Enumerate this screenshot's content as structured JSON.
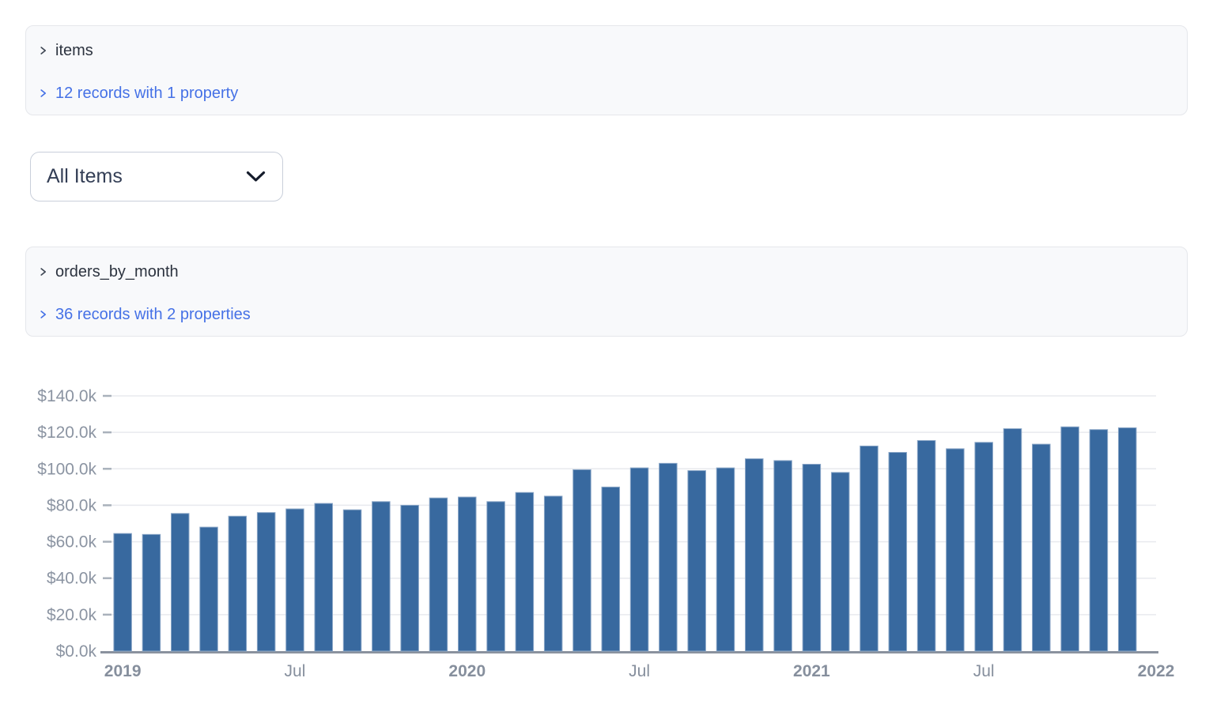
{
  "tables": [
    {
      "name": "items",
      "records_summary": "12 records with 1 property"
    },
    {
      "name": "orders_by_month",
      "records_summary": "36 records with 2 properties"
    }
  ],
  "filter": {
    "selected": "All Items",
    "icon": "chevron-down-icon"
  },
  "icons": {
    "panel_row": "chevron-right-icon",
    "dropdown": "chevron-down-icon"
  },
  "colors": {
    "link_accent": "#4571e6",
    "bar_fill": "#38699f",
    "bar_stroke": "#8aa6c7",
    "panel_bg": "#f8f9fb",
    "panel_border": "#e5e7eb",
    "gridline": "#e8eaee",
    "axis_line": "#8a929e",
    "axis_text": "#8b94a2",
    "x_axis_text": "#868f9d"
  },
  "chart_data": {
    "type": "bar",
    "title": "",
    "xlabel": "",
    "ylabel": "",
    "categories": [
      "Jan 2019",
      "Feb 2019",
      "Mar 2019",
      "Apr 2019",
      "May 2019",
      "Jun 2019",
      "Jul 2019",
      "Aug 2019",
      "Sep 2019",
      "Oct 2019",
      "Nov 2019",
      "Dec 2019",
      "Jan 2020",
      "Feb 2020",
      "Mar 2020",
      "Apr 2020",
      "May 2020",
      "Jun 2020",
      "Jul 2020",
      "Aug 2020",
      "Sep 2020",
      "Oct 2020",
      "Nov 2020",
      "Dec 2020",
      "Jan 2021",
      "Feb 2021",
      "Mar 2021",
      "Apr 2021",
      "May 2021",
      "Jun 2021",
      "Jul 2021",
      "Aug 2021",
      "Sep 2021",
      "Oct 2021",
      "Nov 2021",
      "Dec 2021"
    ],
    "values": [
      64500,
      64000,
      75500,
      68000,
      74000,
      76000,
      78000,
      81000,
      77500,
      82000,
      80000,
      84000,
      84500,
      82000,
      87000,
      85000,
      99500,
      90000,
      100500,
      103000,
      99000,
      100500,
      105500,
      104500,
      102500,
      98000,
      112500,
      109000,
      115500,
      111000,
      114500,
      122000,
      113500,
      123000,
      121500,
      122500
    ],
    "ylim": [
      0,
      140000
    ],
    "ytick_step": 20000,
    "ytick_labels": [
      "$0.0k",
      "$20.0k",
      "$40.0k",
      "$60.0k",
      "$80.0k",
      "$100.0k",
      "$120.0k",
      "$140.0k"
    ],
    "xticks": [
      {
        "index": 0,
        "label": "2019",
        "bold": true
      },
      {
        "index": 6,
        "label": "Jul",
        "bold": false
      },
      {
        "index": 12,
        "label": "2020",
        "bold": true
      },
      {
        "index": 18,
        "label": "Jul",
        "bold": false
      },
      {
        "index": 24,
        "label": "2021",
        "bold": true
      },
      {
        "index": 30,
        "label": "Jul",
        "bold": false
      },
      {
        "index": 36,
        "label": "2022",
        "bold": true
      }
    ],
    "grid": true,
    "legend": false
  }
}
